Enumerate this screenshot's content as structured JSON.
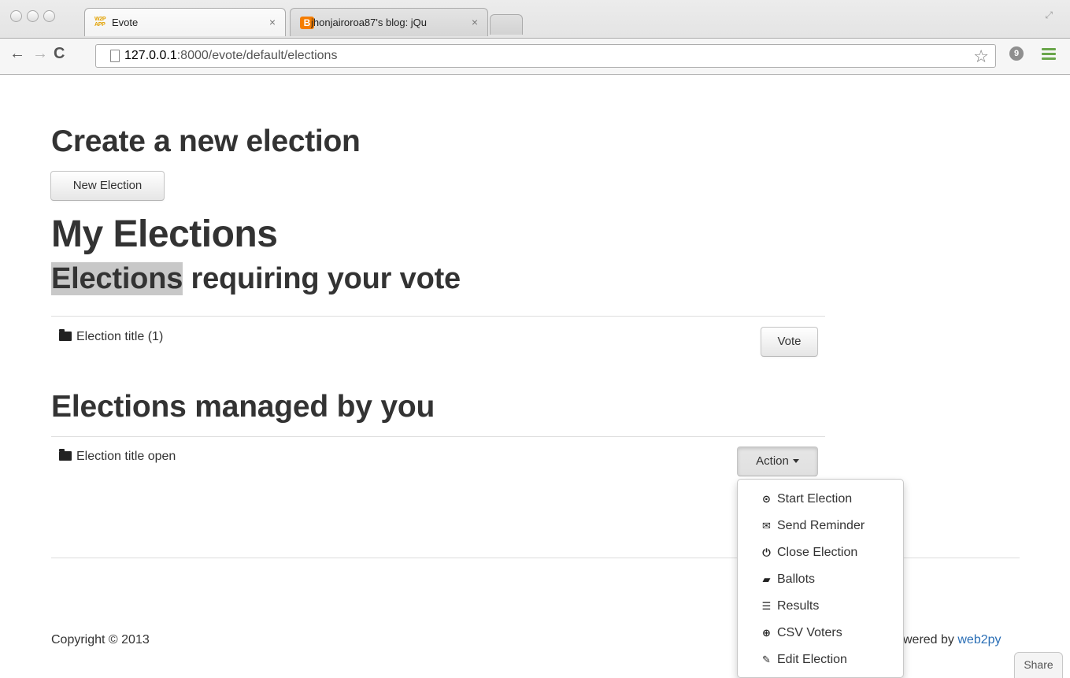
{
  "browser": {
    "tabs": [
      {
        "favicon": "W2P APP",
        "title": "Evote",
        "active": true
      },
      {
        "favicon": "B",
        "title": "jhonjairoroa87's blog: jQu",
        "active": false
      }
    ],
    "url_host": "127.0.0.1",
    "url_rest": ":8000/evote/default/elections"
  },
  "page": {
    "create_heading": "Create a new election",
    "new_election_label": "New Election",
    "my_elections_heading": "My Elections",
    "requiring_heading_highlight": "Elections",
    "requiring_heading_rest": " requiring your vote",
    "requiring_row_title": "Election title (1)",
    "vote_label": "Vote",
    "managed_heading": "Elections managed by you",
    "managed_row_title": "Election title open",
    "action_label": "Action",
    "action_menu": [
      {
        "icon": "start-icon",
        "glyph": "⊙",
        "label": "Start Election"
      },
      {
        "icon": "envelope-icon",
        "glyph": "✉",
        "label": "Send Reminder"
      },
      {
        "icon": "power-icon",
        "glyph": "⏻",
        "label": "Close Election"
      },
      {
        "icon": "folder-open-icon",
        "glyph": "▰",
        "label": "Ballots"
      },
      {
        "icon": "list-icon",
        "glyph": "☰",
        "label": "Results"
      },
      {
        "icon": "download-icon",
        "glyph": "⊕",
        "label": "CSV Voters"
      },
      {
        "icon": "edit-icon",
        "glyph": "✎",
        "label": "Edit Election"
      }
    ],
    "footer": {
      "copyright": "Copyright © 2013",
      "powered_prefix": "wered by ",
      "powered_link": "web2py"
    },
    "share_label": "Share"
  }
}
